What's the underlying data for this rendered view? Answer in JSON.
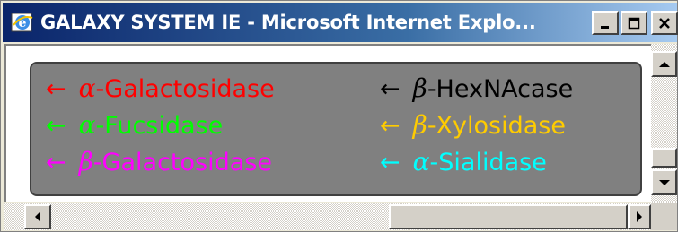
{
  "window": {
    "title": "GALAXY SYSTEM IE - Microsoft Internet Explo...",
    "controls": {
      "minimize_icon": "minimize-icon",
      "maximize_icon": "maximize-icon",
      "close_icon": "close-icon"
    }
  },
  "legend": {
    "background_color": "#808080",
    "items": [
      {
        "arrow": "←",
        "greek": "α",
        "name": "-Galactosidase",
        "color": "#ff0000"
      },
      {
        "arrow": "←",
        "greek": "α",
        "name": "-Fucsidase",
        "color": "#00ff00"
      },
      {
        "arrow": "←",
        "greek": "β",
        "name": "-Galactosidase",
        "color": "#ff00ff"
      },
      {
        "arrow": "←",
        "greek": "β",
        "name": "-HexNAcase",
        "color": "#000000"
      },
      {
        "arrow": "←",
        "greek": "β",
        "name": "-Xylosidase",
        "color": "#ffcc00"
      },
      {
        "arrow": "←",
        "greek": "α",
        "name": "-Sialidase",
        "color": "#00ffff"
      }
    ]
  }
}
